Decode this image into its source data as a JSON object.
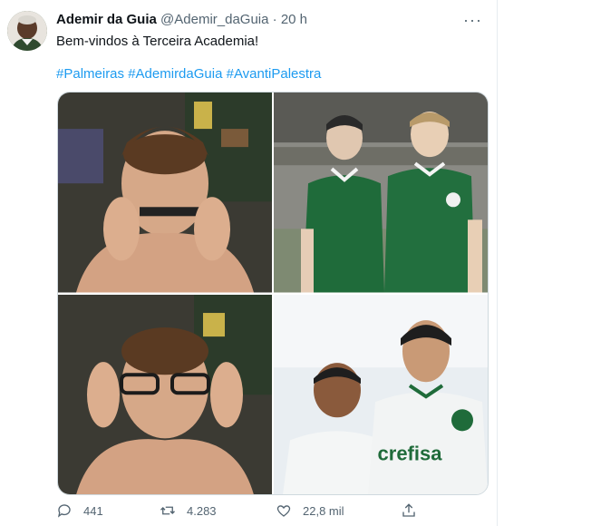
{
  "tweet": {
    "author_name": "Ademir da Guia",
    "handle": "@Ademir_daGuia",
    "separator": "·",
    "time": "20 h",
    "more_label": "···",
    "text": "Bem-vindos à Terceira Academia!",
    "hashtags": [
      "#Palmeiras",
      "#AdemirdaGuia",
      "#AvantiPalestra"
    ],
    "media": [
      {
        "desc": "meme-top-left"
      },
      {
        "desc": "football-players-old-photo"
      },
      {
        "desc": "meme-bottom-left"
      },
      {
        "desc": "football-players-celebrating",
        "jersey_text": "crefisa"
      }
    ]
  },
  "actions": {
    "reply_count": "441",
    "retweet_count": "4.283",
    "like_count": "22,8 mil"
  },
  "colors": {
    "link": "#1d9bf0",
    "muted": "#536471",
    "palmeiras_green": "#1f6b3a"
  }
}
